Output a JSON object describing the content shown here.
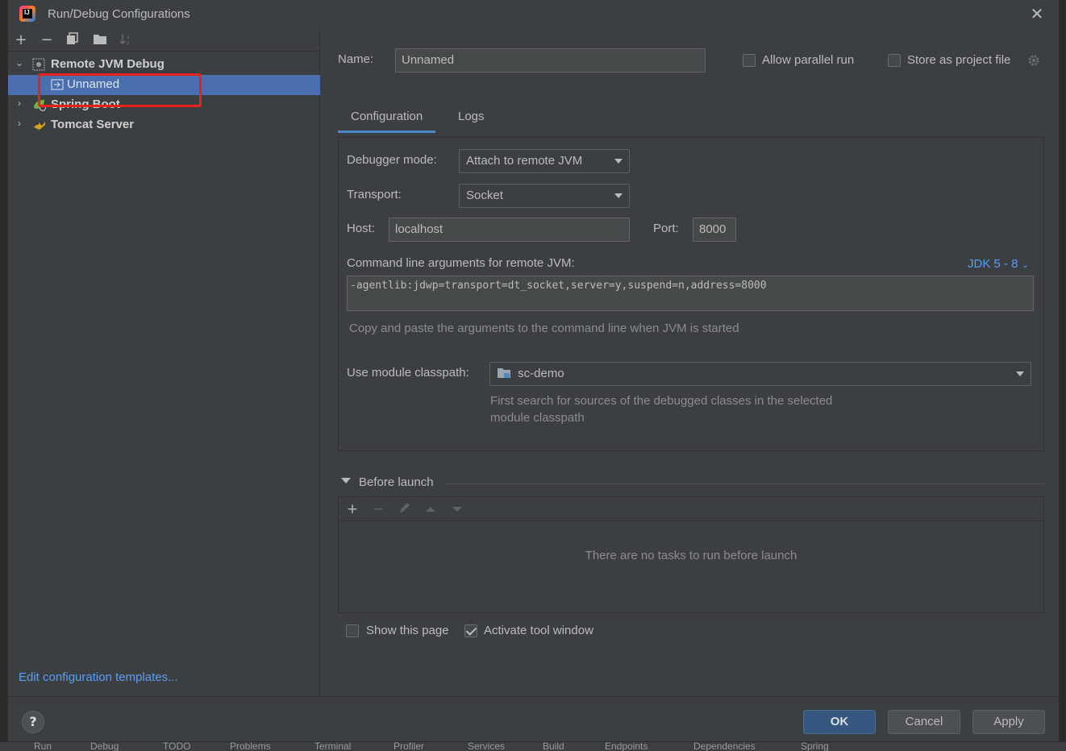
{
  "window": {
    "title": "Run/Debug Configurations"
  },
  "toolbar": {
    "add": "+",
    "remove": "−"
  },
  "tree": {
    "items": [
      {
        "label": "Remote JVM Debug"
      },
      {
        "label": "Unnamed"
      },
      {
        "label": "Spring Boot"
      },
      {
        "label": "Tomcat Server"
      }
    ]
  },
  "left": {
    "edit_templates": "Edit configuration templates..."
  },
  "form": {
    "name_label": "Name:",
    "name_value": "Unnamed",
    "allow_parallel": "Allow parallel run",
    "store_project": "Store as project file",
    "tabs": [
      "Configuration",
      "Logs"
    ],
    "debugger_mode_label": "Debugger mode:",
    "debugger_mode_value": "Attach to remote JVM",
    "transport_label": "Transport:",
    "transport_value": "Socket",
    "host_label": "Host:",
    "host_value": "localhost",
    "port_label": "Port:",
    "port_value": "8000",
    "cmd_label": "Command line arguments for remote JVM:",
    "jdk_link": "JDK 5 - 8",
    "cmd_value": "-agentlib:jdwp=transport=dt_socket,server=y,suspend=n,address=8000",
    "cmd_hint": "Copy and paste the arguments to the command line when JVM is started",
    "module_label": "Use module classpath:",
    "module_value": "sc-demo",
    "module_hint_1": "First search for sources of the debugged classes in the selected",
    "module_hint_2": "module classpath"
  },
  "before_launch": {
    "title": "Before launch",
    "empty": "There are no tasks to run before launch",
    "show_page": "Show this page",
    "activate_tool": "Activate tool window"
  },
  "footer": {
    "help": "?",
    "ok": "OK",
    "cancel": "Cancel",
    "apply": "Apply"
  },
  "ide_toolwindows": [
    "Run",
    "Debug",
    "TODO",
    "Problems",
    "Terminal",
    "Profiler",
    "Services",
    "Build",
    "Endpoints",
    "Dependencies",
    "Spring"
  ]
}
